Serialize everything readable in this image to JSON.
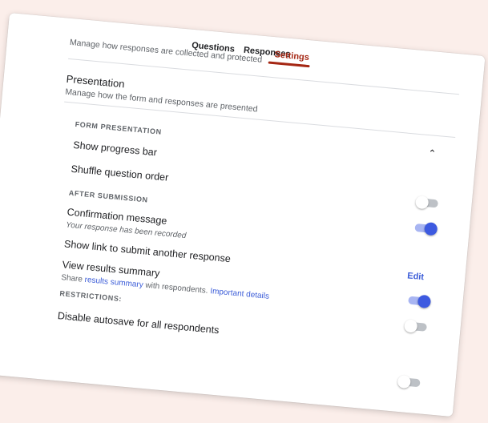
{
  "tabs": [
    {
      "label": "Questions"
    },
    {
      "label": "Responses"
    },
    {
      "label": "Settings",
      "active": true
    }
  ],
  "subheader": "Manage how responses are collected and protected",
  "presentation": {
    "title": "Presentation",
    "description": "Manage how the form and responses are presented",
    "collapse_icon": "chevron-up-icon"
  },
  "form_presentation": {
    "heading": "FORM PRESENTATION",
    "show_progress_bar": {
      "label": "Show progress bar",
      "enabled": false
    },
    "shuffle_question_order": {
      "label": "Shuffle question order",
      "enabled": true
    }
  },
  "after_submission": {
    "heading": "AFTER SUBMISSION",
    "confirmation_message": {
      "label": "Confirmation message",
      "value": "Your response has been recorded",
      "edit_label": "Edit"
    },
    "show_link": {
      "label": "Show link to submit another response",
      "enabled": true
    },
    "view_results_summary": {
      "label": "View results summary",
      "desc_prefix": "Share",
      "desc_link": "results summary",
      "desc_middle": "with respondents.",
      "desc_link2": "Important details",
      "enabled": false
    }
  },
  "restrictions": {
    "heading": "RESTRICTIONS:",
    "disable_autosave": {
      "label": "Disable autosave for all respondents",
      "enabled": false
    }
  },
  "colors": {
    "accent_tab": "#a52714",
    "toggle_on": "#3d5ae0",
    "link": "#3c5dd8",
    "background": "#fbeeea"
  }
}
